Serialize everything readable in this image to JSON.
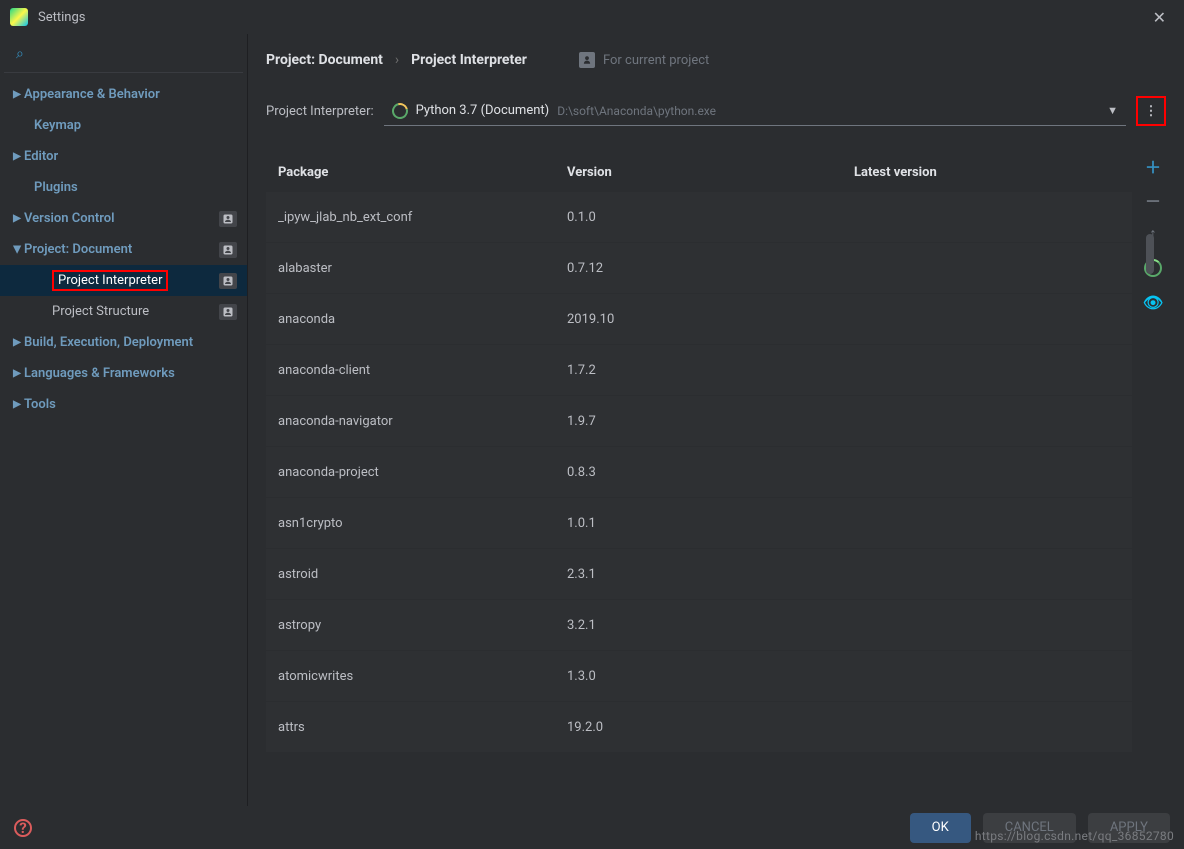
{
  "titlebar": {
    "title": "Settings"
  },
  "sidebar": {
    "items": [
      {
        "label": "Appearance & Behavior",
        "arrow": true
      },
      {
        "label": "Keymap"
      },
      {
        "label": "Editor",
        "arrow": true
      },
      {
        "label": "Plugins"
      },
      {
        "label": "Version Control",
        "arrow": true,
        "badge": true
      },
      {
        "label": "Project: Document",
        "arrow": true,
        "open": true,
        "badge": true
      },
      {
        "label": "Project Interpreter",
        "sub": true,
        "selected": true,
        "badge": true,
        "highlight": true
      },
      {
        "label": "Project Structure",
        "sub": true,
        "badge": true
      },
      {
        "label": "Build, Execution, Deployment",
        "arrow": true
      },
      {
        "label": "Languages & Frameworks",
        "arrow": true
      },
      {
        "label": "Tools",
        "arrow": true
      }
    ]
  },
  "breadcrumb": {
    "root": "Project: Document",
    "leaf": "Project Interpreter",
    "hint": "For current project"
  },
  "interpreter": {
    "label": "Project Interpreter:",
    "name": "Python 3.7 (Document)",
    "path": "D:\\soft\\Anaconda\\python.exe"
  },
  "table": {
    "headers": {
      "package": "Package",
      "version": "Version",
      "latest": "Latest version"
    },
    "rows": [
      {
        "package": "_ipyw_jlab_nb_ext_conf",
        "version": "0.1.0",
        "latest": ""
      },
      {
        "package": "alabaster",
        "version": "0.7.12",
        "latest": ""
      },
      {
        "package": "anaconda",
        "version": "2019.10",
        "latest": ""
      },
      {
        "package": "anaconda-client",
        "version": "1.7.2",
        "latest": ""
      },
      {
        "package": "anaconda-navigator",
        "version": "1.9.7",
        "latest": ""
      },
      {
        "package": "anaconda-project",
        "version": "0.8.3",
        "latest": ""
      },
      {
        "package": "asn1crypto",
        "version": "1.0.1",
        "latest": ""
      },
      {
        "package": "astroid",
        "version": "2.3.1",
        "latest": ""
      },
      {
        "package": "astropy",
        "version": "3.2.1",
        "latest": ""
      },
      {
        "package": "atomicwrites",
        "version": "1.3.0",
        "latest": ""
      },
      {
        "package": "attrs",
        "version": "19.2.0",
        "latest": ""
      }
    ]
  },
  "footer": {
    "ok": "OK",
    "cancel": "CANCEL",
    "apply": "APPLY"
  },
  "watermark": "https://blog.csdn.net/qq_36852780"
}
